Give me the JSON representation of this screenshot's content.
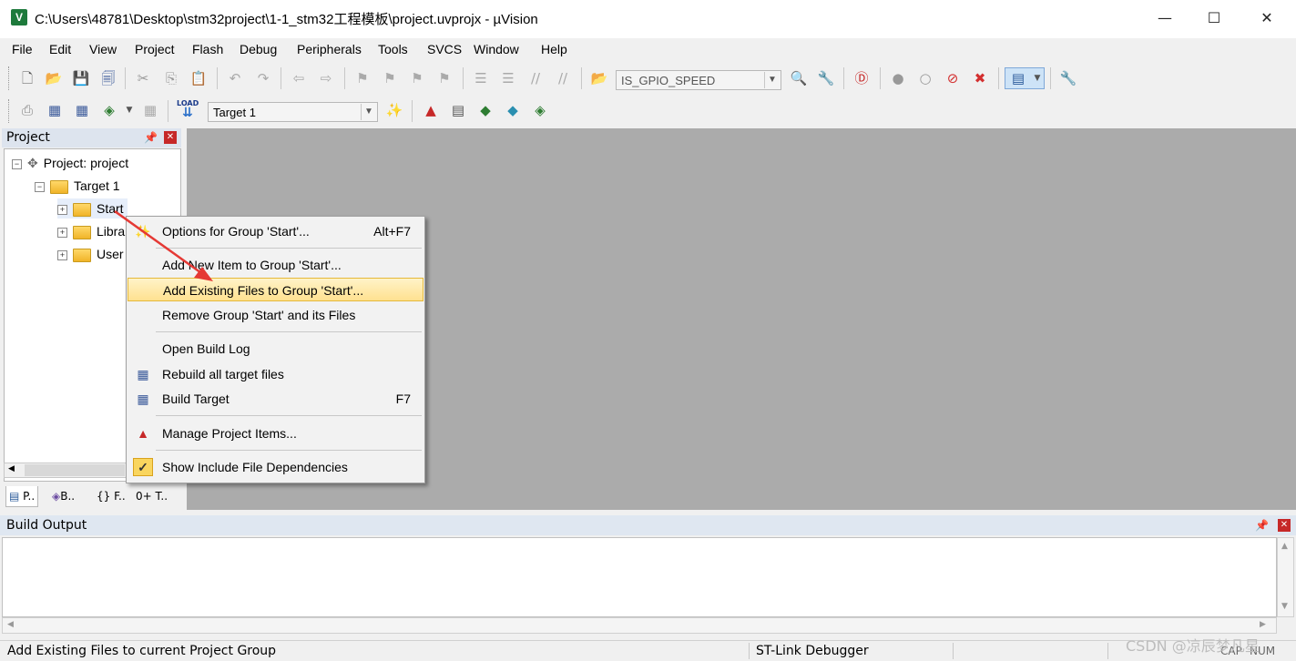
{
  "window": {
    "title": "C:\\Users\\48781\\Desktop\\stm32project\\1-1_stm32工程模板\\project.uvprojx - µVision",
    "app_icon_letter": "V",
    "minimize": "—",
    "maximize": "☐",
    "close": "✕"
  },
  "menu": [
    "File",
    "Edit",
    "View",
    "Project",
    "Flash",
    "Debug",
    "Peripherals",
    "Tools",
    "SVCS",
    "Window",
    "Help"
  ],
  "toolbar1": {
    "find_combo_value": "IS_GPIO_SPEED"
  },
  "toolbar2": {
    "target_combo_value": "Target 1",
    "load_label": "LOAD"
  },
  "project_pane": {
    "title": "Project",
    "tree": {
      "root": "Project: project",
      "target": "Target 1",
      "groups": [
        "Start",
        "Libra",
        "User"
      ]
    },
    "tabs": [
      "P..",
      "B..",
      "{} F..",
      "0+ T.."
    ]
  },
  "context_menu": {
    "items": [
      {
        "label": "Options for Group 'Start'...",
        "shortcut": "Alt+F7",
        "icon": "options-wand-icon"
      },
      {
        "label": "Add New  Item to Group 'Start'...",
        "shortcut": "",
        "icon": ""
      },
      {
        "label": "Add Existing Files to Group 'Start'...",
        "shortcut": "",
        "icon": "",
        "highlighted": true
      },
      {
        "label": "Remove Group 'Start' and its Files",
        "shortcut": "",
        "icon": ""
      },
      {
        "label": "Open Build Log",
        "shortcut": "",
        "icon": ""
      },
      {
        "label": "Rebuild all target files",
        "shortcut": "",
        "icon": "rebuild-icon"
      },
      {
        "label": "Build Target",
        "shortcut": "F7",
        "icon": "build-icon"
      },
      {
        "label": "Manage Project Items...",
        "shortcut": "",
        "icon": "manage-items-icon"
      },
      {
        "label": "Show Include File Dependencies",
        "shortcut": "",
        "icon": "checkmark-icon",
        "checked": true
      }
    ]
  },
  "build_output": {
    "title": "Build Output"
  },
  "status_bar": {
    "message": "Add Existing Files to current Project Group",
    "debugger": "ST-Link Debugger",
    "caps": "CAP",
    "num": "NUM"
  },
  "watermark": "CSDN @凉辰梦凡星",
  "colors": {
    "editor_bg": "#ababab",
    "menu_highlight": "#ffe190",
    "arrow": "#e53935"
  }
}
